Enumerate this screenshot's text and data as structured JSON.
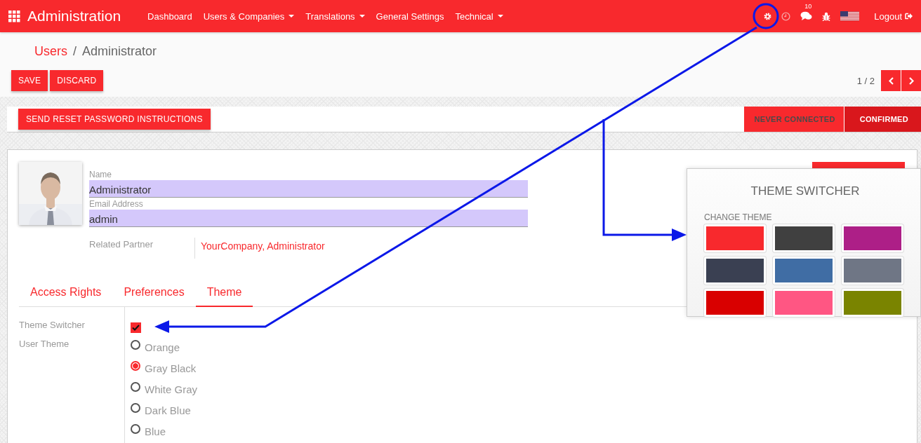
{
  "navbar": {
    "app_title": "Administration",
    "menus": [
      {
        "label": "Dashboard",
        "dropdown": false
      },
      {
        "label": "Users & Companies",
        "dropdown": true
      },
      {
        "label": "Translations",
        "dropdown": true
      },
      {
        "label": "General Settings",
        "dropdown": false
      },
      {
        "label": "Technical",
        "dropdown": true
      }
    ],
    "message_count": "10",
    "logout": "Logout"
  },
  "breadcrumb": {
    "parent": "Users",
    "separator": "/",
    "current": "Administrator"
  },
  "buttons": [
    "SAVE",
    "DISCARD"
  ],
  "pager": "1 / 2",
  "header_button": "SEND RESET PASSWORD INSTRUCTIONS",
  "statuses": [
    {
      "label": "NEVER CONNECTED",
      "selected": false
    },
    {
      "label": "CONFIRMED",
      "selected": true
    }
  ],
  "form": {
    "fields": [
      {
        "label": "Name",
        "value": "Administrator"
      },
      {
        "label": "Email Address",
        "value": "admin"
      }
    ],
    "related_partner": {
      "label": "Related Partner",
      "value": "YourCompany, Administrator"
    }
  },
  "tabs": [
    {
      "label": "Access Rights",
      "selected": false
    },
    {
      "label": "Preferences",
      "selected": false
    },
    {
      "label": "Theme",
      "selected": true
    }
  ],
  "theme_tab": {
    "switcher_label": "Theme Switcher",
    "switcher_checked": true,
    "user_theme_label": "User Theme",
    "options": [
      {
        "label": "Orange",
        "selected": false
      },
      {
        "label": "Gray Black",
        "selected": true
      },
      {
        "label": "White Gray",
        "selected": false
      },
      {
        "label": "Dark Blue",
        "selected": false
      },
      {
        "label": "Blue",
        "selected": false
      }
    ]
  },
  "theme_popup": {
    "title": "THEME SWITCHER",
    "subtitle": "CHANGE THEME",
    "swatches": [
      {
        "color": "#f8292d"
      },
      {
        "color": "#404040"
      },
      {
        "color": "#ad1f87"
      },
      {
        "color": "#3a4052"
      },
      {
        "color": "#406da4"
      },
      {
        "color": "#6f7685"
      },
      {
        "color": "#d90000"
      },
      {
        "color": "#ff5683"
      },
      {
        "color": "#7a8400"
      }
    ]
  }
}
